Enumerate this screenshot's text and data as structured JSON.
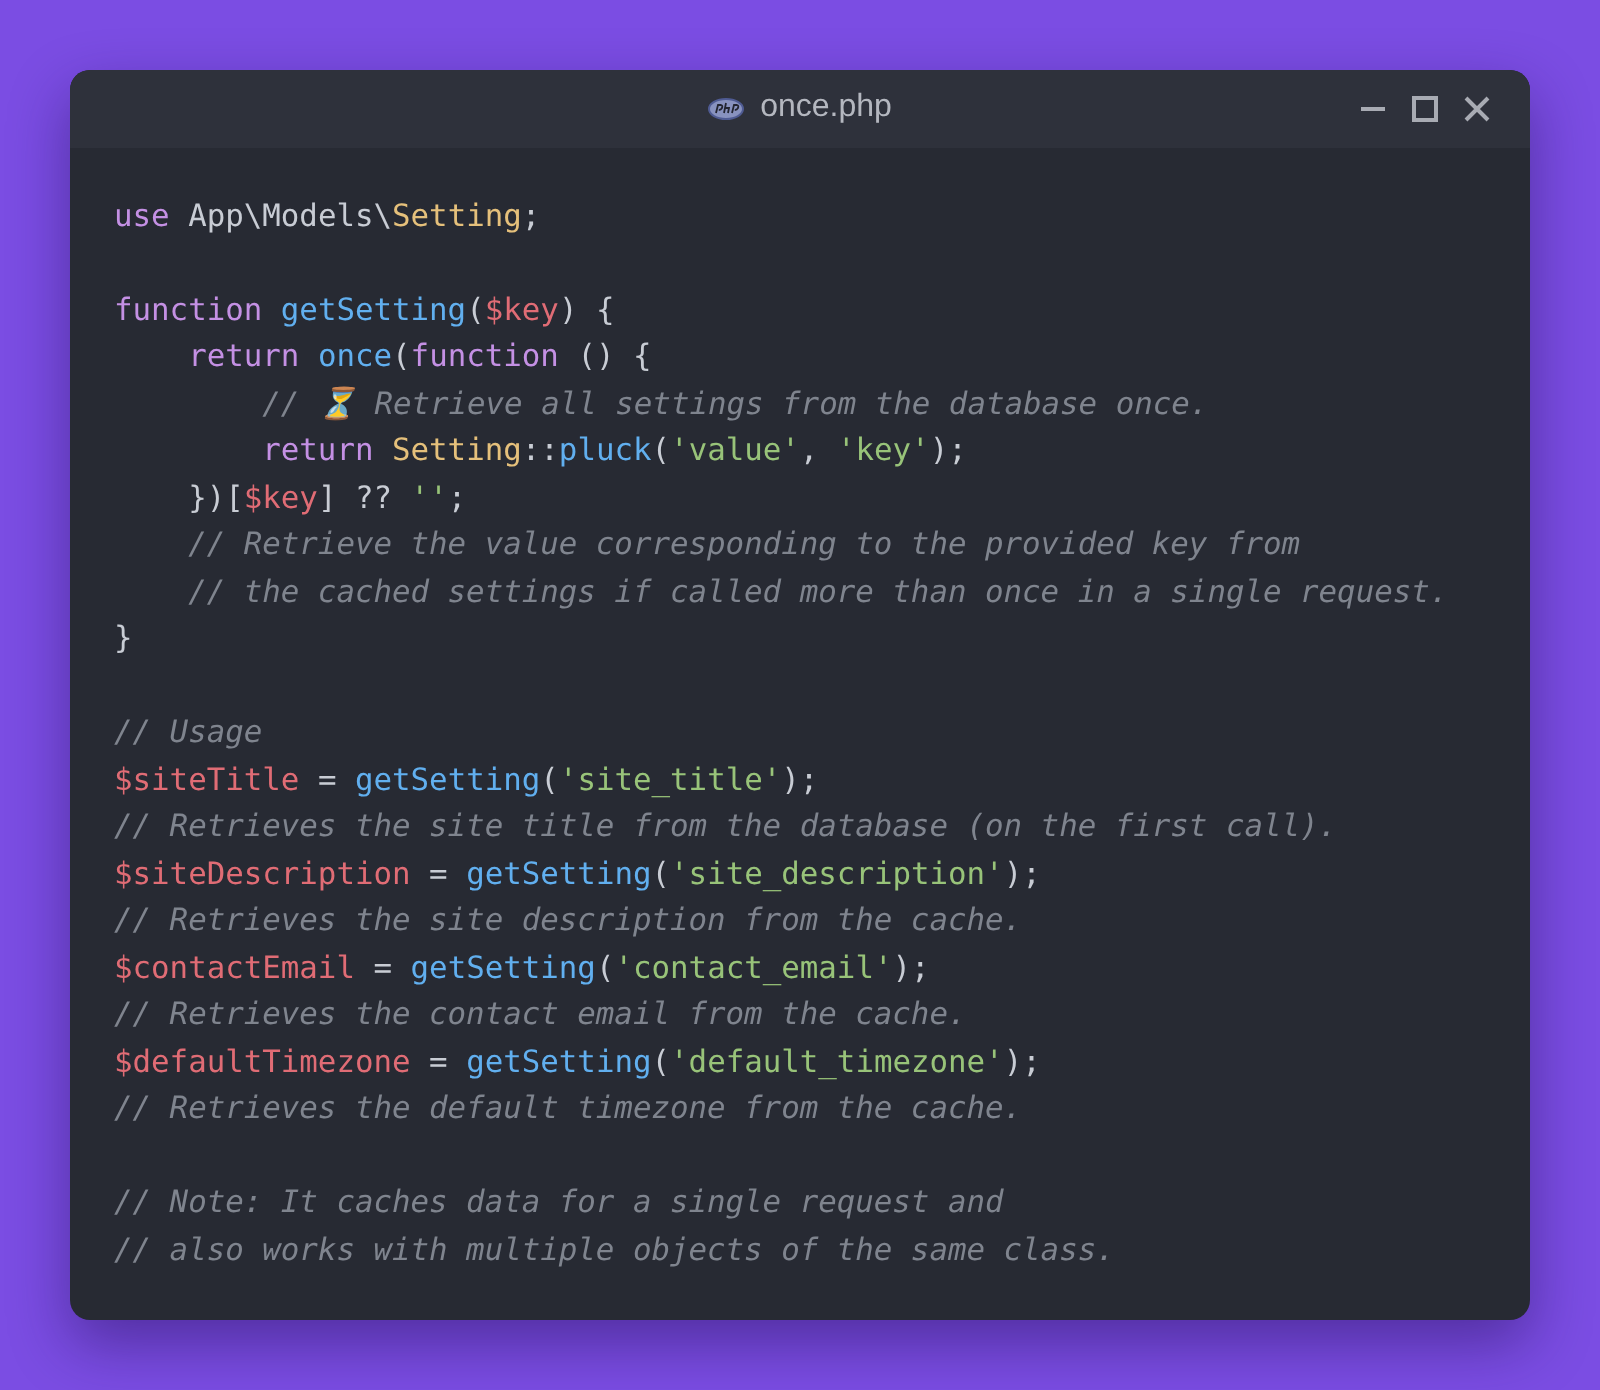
{
  "window": {
    "title": "once.php"
  },
  "code": [
    {
      "kind": "code",
      "tokens": [
        {
          "kind": "keyword",
          "text": "use"
        },
        {
          "kind": "plain",
          "text": " App\\Models\\"
        },
        {
          "kind": "class",
          "text": "Setting"
        },
        {
          "kind": "plain",
          "text": ";"
        }
      ]
    },
    {
      "kind": "blank"
    },
    {
      "kind": "code",
      "tokens": [
        {
          "kind": "keyword",
          "text": "function "
        },
        {
          "kind": "function",
          "text": "getSetting"
        },
        {
          "kind": "plain",
          "text": "("
        },
        {
          "kind": "variable",
          "text": "$key"
        },
        {
          "kind": "plain",
          "text": ") {"
        }
      ]
    },
    {
      "kind": "code",
      "tokens": [
        {
          "kind": "keyword",
          "text": "    return "
        },
        {
          "kind": "function",
          "text": "once"
        },
        {
          "kind": "plain",
          "text": "("
        },
        {
          "kind": "keyword",
          "text": "function"
        },
        {
          "kind": "plain",
          "text": " () {"
        }
      ]
    },
    {
      "kind": "code",
      "tokens": [
        {
          "kind": "comment",
          "text": "        // ⏳ Retrieve all settings from the database once."
        }
      ]
    },
    {
      "kind": "code",
      "tokens": [
        {
          "kind": "keyword",
          "text": "        return "
        },
        {
          "kind": "class",
          "text": "Setting"
        },
        {
          "kind": "plain",
          "text": "::"
        },
        {
          "kind": "function",
          "text": "pluck"
        },
        {
          "kind": "plain",
          "text": "("
        },
        {
          "kind": "string",
          "text": "'value'"
        },
        {
          "kind": "plain",
          "text": ", "
        },
        {
          "kind": "string",
          "text": "'key'"
        },
        {
          "kind": "plain",
          "text": ");"
        }
      ]
    },
    {
      "kind": "code",
      "tokens": [
        {
          "kind": "plain",
          "text": "    })["
        },
        {
          "kind": "variable",
          "text": "$key"
        },
        {
          "kind": "plain",
          "text": "] ?? "
        },
        {
          "kind": "string",
          "text": "''"
        },
        {
          "kind": "plain",
          "text": ";"
        }
      ]
    },
    {
      "kind": "code",
      "tokens": [
        {
          "kind": "comment",
          "text": "    // Retrieve the value corresponding to the provided key from"
        }
      ]
    },
    {
      "kind": "code",
      "tokens": [
        {
          "kind": "comment",
          "text": "    // the cached settings if called more than once in a single request."
        }
      ]
    },
    {
      "kind": "code",
      "tokens": [
        {
          "kind": "plain",
          "text": "}"
        }
      ]
    },
    {
      "kind": "blank"
    },
    {
      "kind": "code",
      "tokens": [
        {
          "kind": "comment",
          "text": "// Usage"
        }
      ]
    },
    {
      "kind": "code",
      "tokens": [
        {
          "kind": "variable",
          "text": "$siteTitle"
        },
        {
          "kind": "plain",
          "text": " = "
        },
        {
          "kind": "function",
          "text": "getSetting"
        },
        {
          "kind": "plain",
          "text": "("
        },
        {
          "kind": "string",
          "text": "'site_title'"
        },
        {
          "kind": "plain",
          "text": ");"
        }
      ]
    },
    {
      "kind": "code",
      "tokens": [
        {
          "kind": "comment",
          "text": "// Retrieves the site title from the database (on the first call)."
        }
      ]
    },
    {
      "kind": "code",
      "tokens": [
        {
          "kind": "variable",
          "text": "$siteDescription"
        },
        {
          "kind": "plain",
          "text": " = "
        },
        {
          "kind": "function",
          "text": "getSetting"
        },
        {
          "kind": "plain",
          "text": "("
        },
        {
          "kind": "string",
          "text": "'site_description'"
        },
        {
          "kind": "plain",
          "text": ");"
        }
      ]
    },
    {
      "kind": "code",
      "tokens": [
        {
          "kind": "comment",
          "text": "// Retrieves the site description from the cache."
        }
      ]
    },
    {
      "kind": "code",
      "tokens": [
        {
          "kind": "variable",
          "text": "$contactEmail"
        },
        {
          "kind": "plain",
          "text": " = "
        },
        {
          "kind": "function",
          "text": "getSetting"
        },
        {
          "kind": "plain",
          "text": "("
        },
        {
          "kind": "string",
          "text": "'contact_email'"
        },
        {
          "kind": "plain",
          "text": ");"
        }
      ]
    },
    {
      "kind": "code",
      "tokens": [
        {
          "kind": "comment",
          "text": "// Retrieves the contact email from the cache."
        }
      ]
    },
    {
      "kind": "code",
      "tokens": [
        {
          "kind": "variable",
          "text": "$defaultTimezone"
        },
        {
          "kind": "plain",
          "text": " = "
        },
        {
          "kind": "function",
          "text": "getSetting"
        },
        {
          "kind": "plain",
          "text": "("
        },
        {
          "kind": "string",
          "text": "'default_timezone'"
        },
        {
          "kind": "plain",
          "text": ");"
        }
      ]
    },
    {
      "kind": "code",
      "tokens": [
        {
          "kind": "comment",
          "text": "// Retrieves the default timezone from the cache."
        }
      ]
    },
    {
      "kind": "blank"
    },
    {
      "kind": "code",
      "tokens": [
        {
          "kind": "comment",
          "text": "// Note: It caches data for a single request and"
        }
      ]
    },
    {
      "kind": "code",
      "tokens": [
        {
          "kind": "comment",
          "text": "// also works with multiple objects of the same class."
        }
      ]
    }
  ]
}
